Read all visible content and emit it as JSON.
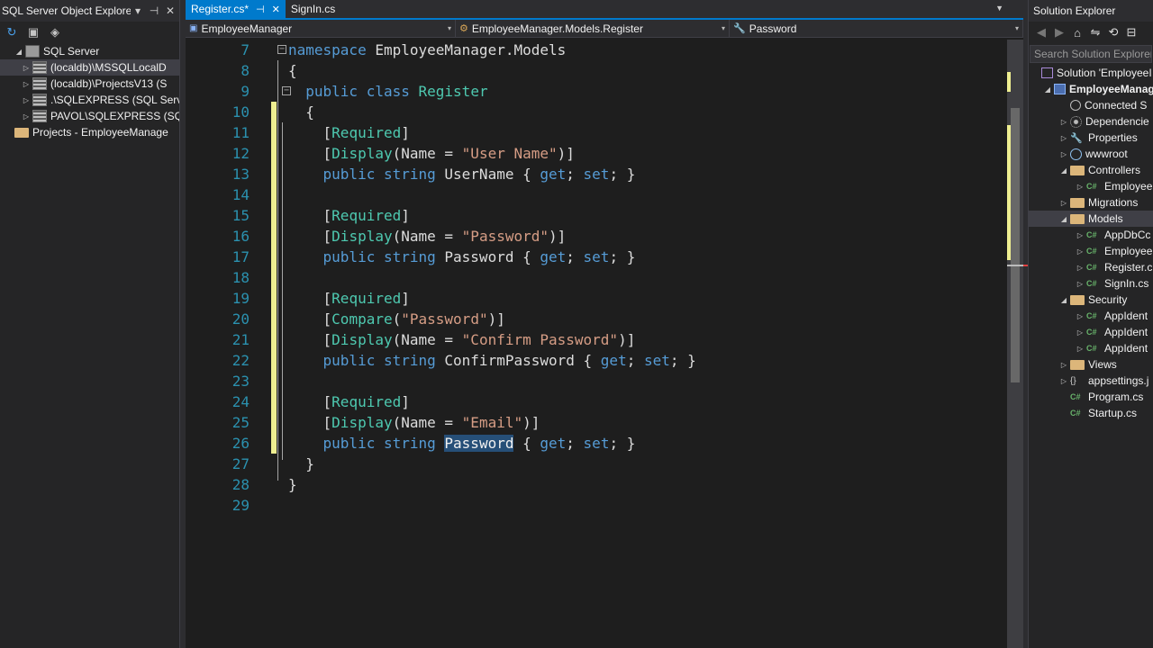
{
  "sql_explorer": {
    "title": "SQL Server Object Explorer",
    "root": "SQL Server",
    "servers": [
      "(localdb)\\MSSQLLocalD",
      "(localdb)\\ProjectsV13 (S",
      ".\\SQLEXPRESS (SQL Serv",
      "PAVOL\\SQLEXPRESS (SQ"
    ],
    "projects": "Projects - EmployeeManage"
  },
  "tabs": [
    {
      "label": "Register.cs*",
      "active": true
    },
    {
      "label": "SignIn.cs",
      "active": false
    }
  ],
  "navbar": {
    "project": "EmployeeManager",
    "type": "EmployeeManager.Models.Register",
    "member": "Password"
  },
  "code": [
    {
      "n": "7",
      "t": [
        [
          "kw",
          "namespace"
        ],
        [
          "tx",
          " EmployeeManager.Models"
        ]
      ]
    },
    {
      "n": "8",
      "t": [
        [
          "tx",
          "{"
        ]
      ]
    },
    {
      "n": "9",
      "t": [
        [
          "tx",
          "  "
        ],
        [
          "kw",
          "public"
        ],
        [
          "tx",
          " "
        ],
        [
          "kw",
          "class"
        ],
        [
          "tx",
          " "
        ],
        [
          "ty",
          "Register"
        ]
      ]
    },
    {
      "n": "10",
      "t": [
        [
          "tx",
          "  {"
        ]
      ]
    },
    {
      "n": "11",
      "t": [
        [
          "tx",
          "    ["
        ],
        [
          "ty",
          "Required"
        ],
        [
          "tx",
          "]"
        ]
      ]
    },
    {
      "n": "12",
      "t": [
        [
          "tx",
          "    ["
        ],
        [
          "ty",
          "Display"
        ],
        [
          "tx",
          "(Name = "
        ],
        [
          "st",
          "\"User Name\""
        ],
        [
          "tx",
          ")]"
        ]
      ]
    },
    {
      "n": "13",
      "t": [
        [
          "tx",
          "    "
        ],
        [
          "kw",
          "public"
        ],
        [
          "tx",
          " "
        ],
        [
          "kw",
          "string"
        ],
        [
          "tx",
          " UserName { "
        ],
        [
          "kw",
          "get"
        ],
        [
          "tx",
          "; "
        ],
        [
          "kw",
          "set"
        ],
        [
          "tx",
          "; }"
        ]
      ]
    },
    {
      "n": "14",
      "t": []
    },
    {
      "n": "15",
      "t": [
        [
          "tx",
          "    ["
        ],
        [
          "ty",
          "Required"
        ],
        [
          "tx",
          "]"
        ]
      ]
    },
    {
      "n": "16",
      "t": [
        [
          "tx",
          "    ["
        ],
        [
          "ty",
          "Display"
        ],
        [
          "tx",
          "(Name = "
        ],
        [
          "st",
          "\"Password\""
        ],
        [
          "tx",
          ")]"
        ]
      ]
    },
    {
      "n": "17",
      "t": [
        [
          "tx",
          "    "
        ],
        [
          "kw",
          "public"
        ],
        [
          "tx",
          " "
        ],
        [
          "kw",
          "string"
        ],
        [
          "tx",
          " Password { "
        ],
        [
          "kw",
          "get"
        ],
        [
          "tx",
          "; "
        ],
        [
          "kw",
          "set"
        ],
        [
          "tx",
          "; }"
        ]
      ]
    },
    {
      "n": "18",
      "t": []
    },
    {
      "n": "19",
      "t": [
        [
          "tx",
          "    ["
        ],
        [
          "ty",
          "Required"
        ],
        [
          "tx",
          "]"
        ]
      ]
    },
    {
      "n": "20",
      "t": [
        [
          "tx",
          "    ["
        ],
        [
          "ty",
          "Compare"
        ],
        [
          "tx",
          "("
        ],
        [
          "st",
          "\"Password\""
        ],
        [
          "tx",
          ")]"
        ]
      ]
    },
    {
      "n": "21",
      "t": [
        [
          "tx",
          "    ["
        ],
        [
          "ty",
          "Display"
        ],
        [
          "tx",
          "(Name = "
        ],
        [
          "st",
          "\"Confirm Password\""
        ],
        [
          "tx",
          ")]"
        ]
      ]
    },
    {
      "n": "22",
      "t": [
        [
          "tx",
          "    "
        ],
        [
          "kw",
          "public"
        ],
        [
          "tx",
          " "
        ],
        [
          "kw",
          "string"
        ],
        [
          "tx",
          " ConfirmPassword { "
        ],
        [
          "kw",
          "get"
        ],
        [
          "tx",
          "; "
        ],
        [
          "kw",
          "set"
        ],
        [
          "tx",
          "; }"
        ]
      ]
    },
    {
      "n": "23",
      "t": []
    },
    {
      "n": "24",
      "t": [
        [
          "tx",
          "    ["
        ],
        [
          "ty",
          "Required"
        ],
        [
          "tx",
          "]"
        ]
      ]
    },
    {
      "n": "25",
      "t": [
        [
          "tx",
          "    ["
        ],
        [
          "ty",
          "Display"
        ],
        [
          "tx",
          "(Name = "
        ],
        [
          "st",
          "\"Email\""
        ],
        [
          "tx",
          ")]"
        ]
      ]
    },
    {
      "n": "26",
      "t": [
        [
          "tx",
          "    "
        ],
        [
          "kw",
          "public"
        ],
        [
          "tx",
          " "
        ],
        [
          "kw",
          "string"
        ],
        [
          "tx",
          " "
        ],
        [
          "hl",
          "Password"
        ],
        [
          "tx",
          " { "
        ],
        [
          "kw",
          "get"
        ],
        [
          "tx",
          "; "
        ],
        [
          "kw",
          "set"
        ],
        [
          "tx",
          "; }"
        ]
      ]
    },
    {
      "n": "27",
      "t": [
        [
          "tx",
          "  }"
        ]
      ]
    },
    {
      "n": "28",
      "t": [
        [
          "tx",
          "}"
        ]
      ]
    },
    {
      "n": "29",
      "t": []
    }
  ],
  "solution_explorer": {
    "title": "Solution Explorer",
    "search_placeholder": "Search Solution Explorer",
    "items": [
      {
        "label": "Solution 'EmployeeI",
        "icon": "solution-icon",
        "depth": 0
      },
      {
        "label": "EmployeeManag",
        "icon": "project-icon",
        "depth": 1,
        "bold": true
      },
      {
        "label": "Connected S",
        "icon": "connected-services-icon",
        "depth": 2
      },
      {
        "label": "Dependencie",
        "icon": "dependencies-icon",
        "depth": 2
      },
      {
        "label": "Properties",
        "icon": "wrench-icon",
        "depth": 2
      },
      {
        "label": "wwwroot",
        "icon": "globe-icon",
        "depth": 2
      },
      {
        "label": "Controllers",
        "icon": "folder-icon",
        "depth": 2
      },
      {
        "label": "Employee",
        "icon": "csharp-file-icon",
        "depth": 3
      },
      {
        "label": "Migrations",
        "icon": "folder-icon",
        "depth": 2
      },
      {
        "label": "Models",
        "icon": "folder-icon",
        "depth": 2,
        "selected": true
      },
      {
        "label": "AppDbCc",
        "icon": "csharp-file-icon",
        "depth": 3
      },
      {
        "label": "Employee",
        "icon": "csharp-file-icon",
        "depth": 3
      },
      {
        "label": "Register.c",
        "icon": "csharp-file-icon",
        "depth": 3
      },
      {
        "label": "SignIn.cs",
        "icon": "csharp-file-icon",
        "depth": 3
      },
      {
        "label": "Security",
        "icon": "folder-icon",
        "depth": 2
      },
      {
        "label": "AppIdent",
        "icon": "csharp-file-icon",
        "depth": 3
      },
      {
        "label": "AppIdent",
        "icon": "csharp-file-icon",
        "depth": 3
      },
      {
        "label": "AppIdent",
        "icon": "csharp-file-icon",
        "depth": 3
      },
      {
        "label": "Views",
        "icon": "folder-icon",
        "depth": 2
      },
      {
        "label": "appsettings.j",
        "icon": "json-file-icon",
        "depth": 2
      },
      {
        "label": "Program.cs",
        "icon": "csharp-file-icon",
        "depth": 2
      },
      {
        "label": "Startup.cs",
        "icon": "csharp-file-icon",
        "depth": 2
      }
    ]
  }
}
